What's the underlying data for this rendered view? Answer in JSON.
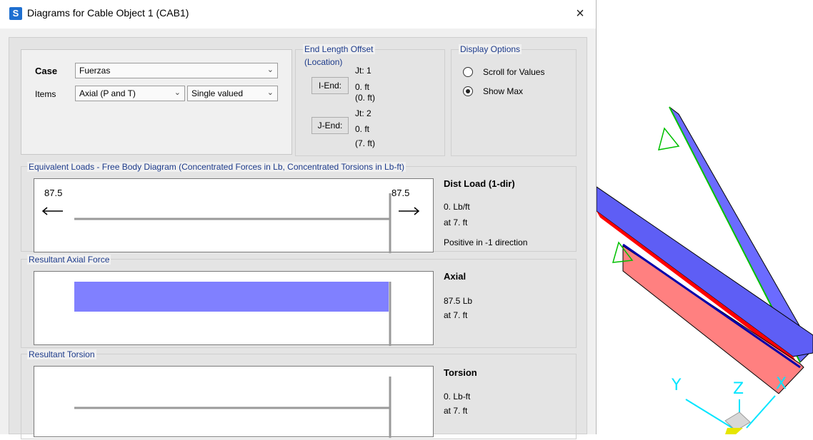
{
  "window": {
    "title": "Diagrams for Cable Object 1  (CAB1)",
    "app_icon_letter": "S",
    "close_glyph": "×"
  },
  "case_panel": {
    "case_label": "Case",
    "case_value": "Fuerzas",
    "items_label": "Items",
    "items_value": "Axial (P and T)",
    "valued_value": "Single valued"
  },
  "end_length_offset": {
    "title": "End Length Offset",
    "subtitle": "(Location)",
    "i_end_button": "I-End:",
    "j_end_button": "J-End:",
    "jt1": "Jt:  1",
    "i_val": "0. ft",
    "i_loc": "(0. ft)",
    "jt2": "Jt:  2",
    "j_val": "0. ft",
    "j_loc": "(7. ft)"
  },
  "display_options": {
    "title": "Display Options",
    "opt1": "Scroll for Values",
    "opt2": "Show Max",
    "selected": "Show Max"
  },
  "fbd": {
    "title": "Equivalent Loads - Free Body Diagram  (Concentrated Forces in Lb, Concentrated Torsions in Lb-ft)",
    "left_value": "87.5",
    "right_value": "87.5",
    "info_title": "Dist Load (1-dir)",
    "info_1": "0. Lb/ft",
    "info_2": "at 7. ft",
    "info_3": "Positive in -1 direction"
  },
  "axial": {
    "title": "Resultant Axial Force",
    "info_title": "Axial",
    "info_1": "87.5 Lb",
    "info_2": "at 7. ft",
    "fill_color": "#8080ff"
  },
  "torsion": {
    "title": "Resultant Torsion",
    "info_title": "Torsion",
    "info_1": "0. Lb-ft",
    "info_2": "at 7. ft"
  },
  "viewport": {
    "axis_y": "Y",
    "axis_z": "Z",
    "axis_x": "X"
  }
}
